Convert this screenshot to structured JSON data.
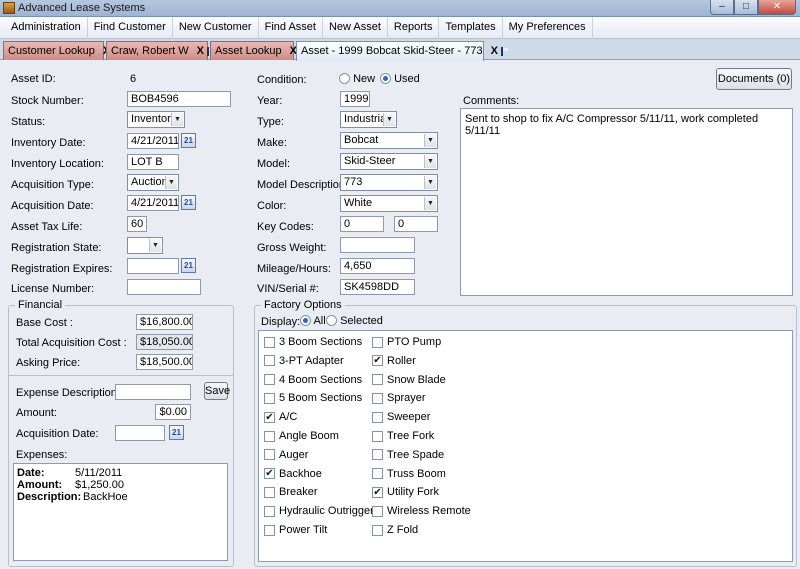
{
  "window": {
    "title": "Advanced Lease Systems",
    "min_glyph": "–",
    "max_glyph": "□",
    "close_glyph": "✕"
  },
  "menu": [
    "Administration",
    "Find Customer",
    "New Customer",
    "Find Asset",
    "New Asset",
    "Reports",
    "Templates",
    "My Preferences"
  ],
  "tabs": [
    {
      "label": "Customer Lookup",
      "close": "X"
    },
    {
      "label": "Craw, Robert W",
      "close": "X"
    },
    {
      "label": "Asset Lookup",
      "close": "X"
    },
    {
      "label": "Asset - 1999 Bobcat Skid-Steer - 773",
      "close": "X"
    }
  ],
  "left": {
    "asset_id_label": "Asset ID:",
    "asset_id_value": "6",
    "stock_label": "Stock Number:",
    "stock_value": "BOB4596",
    "status_label": "Status:",
    "status_value": "Inventory",
    "inv_date_label": "Inventory Date:",
    "inv_date_value": "4/21/2011",
    "inv_loc_label": "Inventory Location:",
    "inv_loc_value": "LOT B",
    "acq_type_label": "Acquisition Type:",
    "acq_type_value": "Auction",
    "acq_date_label": "Acquisition Date:",
    "acq_date_value": "4/21/2011",
    "tax_life_label": "Asset Tax Life:",
    "tax_life_value": "60",
    "reg_state_label": "Registration State:",
    "reg_state_value": "",
    "reg_exp_label": "Registration Expires:",
    "reg_exp_value": "",
    "license_label": "License Number:",
    "license_value": ""
  },
  "calendar_glyph": "21",
  "dropdown_glyph": "▼",
  "middle": {
    "condition_label": "Condition:",
    "cond_new": "New",
    "cond_used": "Used",
    "year_label": "Year:",
    "year_value": "1999",
    "type_label": "Type:",
    "type_value": "Industrial",
    "make_label": "Make:",
    "make_value": "Bobcat",
    "model_label": "Model:",
    "model_value": "Skid-Steer",
    "model_desc_label": "Model Description:",
    "model_desc_value": "773",
    "color_label": "Color:",
    "color_value": "White",
    "key_codes_label": "Key Codes:",
    "key_code_1": "0",
    "key_code_2": "0",
    "gross_weight_label": "Gross Weight:",
    "gross_weight_value": "",
    "mileage_label": "Mileage/Hours:",
    "mileage_value": "4,650",
    "vin_label": "VIN/Serial #:",
    "vin_value": "SK4598DD"
  },
  "documents_button": "Documents (0)",
  "comments": {
    "label": "Comments:",
    "text": "Sent to shop to fix A/C Compressor 5/11/11, work completed 5/11/11"
  },
  "financial": {
    "legend": "Financial",
    "base_cost_label": "Base Cost :",
    "base_cost_value": "$16,800.00",
    "total_acq_label": "Total Acquisition Cost :",
    "total_acq_value": "$18,050.00",
    "asking_label": "Asking Price:",
    "asking_value": "$18,500.00",
    "exp_desc_label": "Expense Description:",
    "exp_desc_value": "",
    "save_label": "Save",
    "amount_label": "Amount:",
    "amount_value": "$0.00",
    "acq_date_label": "Acquisition Date:",
    "acq_date_value": "",
    "expenses_label": "Expenses:",
    "expense": {
      "date_label": "Date:",
      "date_value": "5/11/2011",
      "amount_label": "Amount:",
      "amount_value": "$1,250.00",
      "desc_label": "Description:",
      "desc_value": "BackHoe"
    }
  },
  "factory": {
    "legend": "Factory Options",
    "display_label": "Display:",
    "all_label": "All",
    "selected_label": "Selected",
    "check_glyph": "✔",
    "col1": [
      {
        "label": "3 Boom Sections",
        "checked": false
      },
      {
        "label": "3-PT Adapter",
        "checked": false
      },
      {
        "label": "4 Boom Sections",
        "checked": false
      },
      {
        "label": "5 Boom Sections",
        "checked": false
      },
      {
        "label": "A/C",
        "checked": true
      },
      {
        "label": "Angle Boom",
        "checked": false
      },
      {
        "label": "Auger",
        "checked": false
      },
      {
        "label": "Backhoe",
        "checked": true
      },
      {
        "label": "Breaker",
        "checked": false
      },
      {
        "label": "Hydraulic Outrigger",
        "checked": false
      },
      {
        "label": "Power Tilt",
        "checked": false
      }
    ],
    "col2": [
      {
        "label": "PTO Pump",
        "checked": false
      },
      {
        "label": "Roller",
        "checked": true
      },
      {
        "label": "Snow Blade",
        "checked": false
      },
      {
        "label": "Sprayer",
        "checked": false
      },
      {
        "label": "Sweeper",
        "checked": false
      },
      {
        "label": "Tree Fork",
        "checked": false
      },
      {
        "label": "Tree Spade",
        "checked": false
      },
      {
        "label": "Truss Boom",
        "checked": false
      },
      {
        "label": "Utility Fork",
        "checked": true
      },
      {
        "label": "Wireless Remote",
        "checked": false
      },
      {
        "label": "Z Fold",
        "checked": false
      }
    ]
  }
}
